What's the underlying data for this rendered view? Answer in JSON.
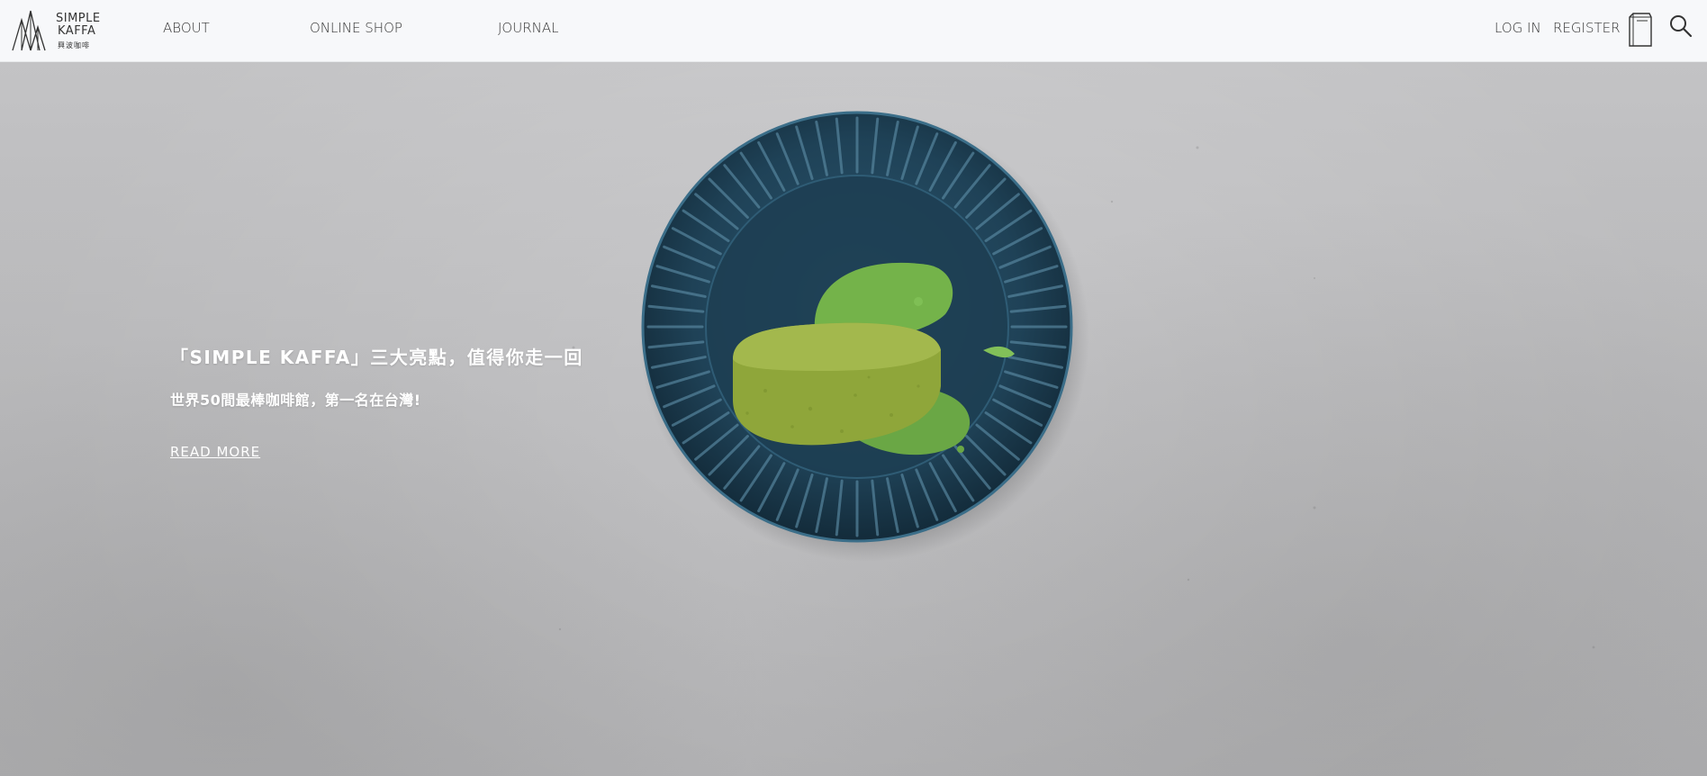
{
  "brand": {
    "line1": "SIMPLE",
    "line2": "KAFFA",
    "line3": "興波咖啡"
  },
  "nav": {
    "items": [
      {
        "label": "ABOUT"
      },
      {
        "label": "ONLINE SHOP"
      },
      {
        "label": "JOURNAL"
      }
    ],
    "login_label": "LOG IN",
    "register_label": "REGISTER"
  },
  "icons": {
    "cart": "coffee-bag-icon",
    "search": "search-icon"
  },
  "hero": {
    "title": "「SIMPLE KAFFA」三大亮點，值得你走一回",
    "subtitle": "世界50間最棒咖啡館，第一名在台灣!",
    "link_label": "READ MORE"
  },
  "colors": {
    "nav_bg": "#f7f8fa",
    "nav_text": "#333333",
    "plate": "#1f4257",
    "cake": "#8fa63a",
    "cream": "#74b34a",
    "hero_text": "#ffffff"
  }
}
